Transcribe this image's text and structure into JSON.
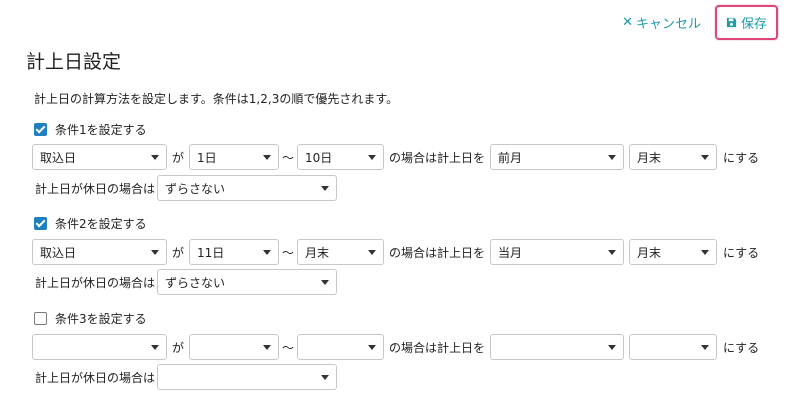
{
  "header": {
    "cancel_label": "キャンセル",
    "save_label": "保存"
  },
  "title": "計上日設定",
  "description": "計上日の計算方法を設定します。条件は1,2,3の順で優先されます。",
  "labels": {
    "ga": "が",
    "tilde": "〜",
    "case_text": "の場合は計上日を",
    "suru": "にする",
    "holiday": "計上日が休日の場合は"
  },
  "conditions": [
    {
      "label": "条件1を設定する",
      "checked": true,
      "base": "取込日",
      "from": "1日",
      "to": "10日",
      "month": "前月",
      "day": "月末",
      "shift": "ずらさない"
    },
    {
      "label": "条件2を設定する",
      "checked": true,
      "base": "取込日",
      "from": "11日",
      "to": "月末",
      "month": "当月",
      "day": "月末",
      "shift": "ずらさない"
    },
    {
      "label": "条件3を設定する",
      "checked": false,
      "base": "",
      "from": "",
      "to": "",
      "month": "",
      "day": "",
      "shift": ""
    }
  ],
  "colors": {
    "accent": "#1f9ba8",
    "highlight": "#e0457b",
    "checkbox": "#1f7fbf"
  }
}
